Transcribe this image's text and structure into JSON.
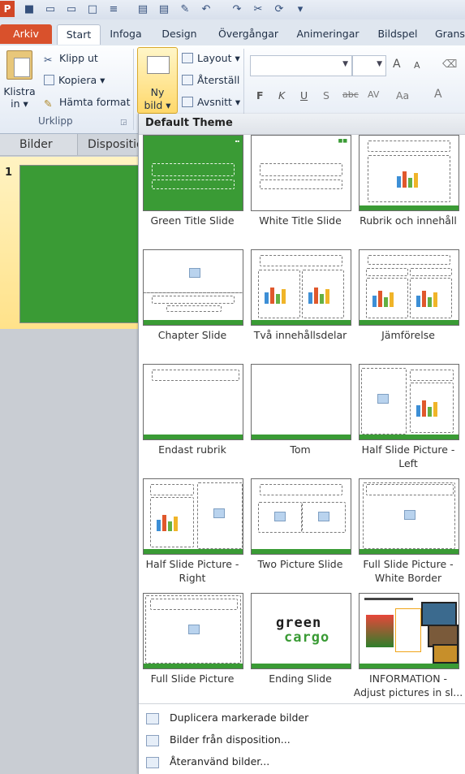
{
  "app": {
    "logo_letter": "P"
  },
  "tabs": [
    "Arkiv",
    "Start",
    "Infoga",
    "Design",
    "Övergångar",
    "Animeringar",
    "Bildspel",
    "Grans"
  ],
  "ribbon": {
    "clipboard": {
      "paste_label_1": "Klistra",
      "paste_label_2": "in ▾",
      "cut": "Klipp ut",
      "copy": "Kopiera ▾",
      "format_painter": "Hämta format",
      "group_label": "Urklipp"
    },
    "slides": {
      "new_slide_1": "Ny",
      "new_slide_2": "bild ▾",
      "layout": "Layout ▾",
      "reset": "Återställ",
      "section": "Avsnitt ▾"
    },
    "font": {
      "bold": "F",
      "italic": "K",
      "underline": "U",
      "shadow": "S",
      "strike": "abc",
      "spacing": "AV",
      "case": "Aa",
      "color": "A",
      "grow": "A",
      "shrink": "A"
    }
  },
  "left_panel": {
    "tab_slides": "Bilder",
    "tab_outline": "Dispositio",
    "slide_number": "1"
  },
  "gallery": {
    "title": "Default Theme",
    "layouts": [
      {
        "name": "Green Title Slide",
        "name2": ""
      },
      {
        "name": "White Title Slide",
        "name2": ""
      },
      {
        "name": "Rubrik och innehåll",
        "name2": ""
      },
      {
        "name": "Chapter Slide",
        "name2": ""
      },
      {
        "name": "Två innehållsdelar",
        "name2": ""
      },
      {
        "name": "Jämförelse",
        "name2": ""
      },
      {
        "name": "Endast rubrik",
        "name2": ""
      },
      {
        "name": "Tom",
        "name2": ""
      },
      {
        "name": "Half Slide Picture -",
        "name2": "Left"
      },
      {
        "name": "Half Slide Picture -",
        "name2": "Right"
      },
      {
        "name": "Two Picture Slide",
        "name2": ""
      },
      {
        "name": "Full Slide Picture -",
        "name2": "White Border"
      },
      {
        "name": "Full Slide Picture",
        "name2": ""
      },
      {
        "name": "Ending Slide",
        "name2": ""
      },
      {
        "name": "INFORMATION -",
        "name2": "Adjust pictures in sl..."
      }
    ],
    "logo_line1": "green",
    "logo_line2": "cargo",
    "commands": [
      "Duplicera markerade bilder",
      "Bilder från disposition...",
      "Återanvänd bilder..."
    ]
  },
  "colors": {
    "brand_green": "#3a9b35",
    "arkiv_tab": "#d9512c",
    "selection_yellow": "#ffe28a"
  }
}
